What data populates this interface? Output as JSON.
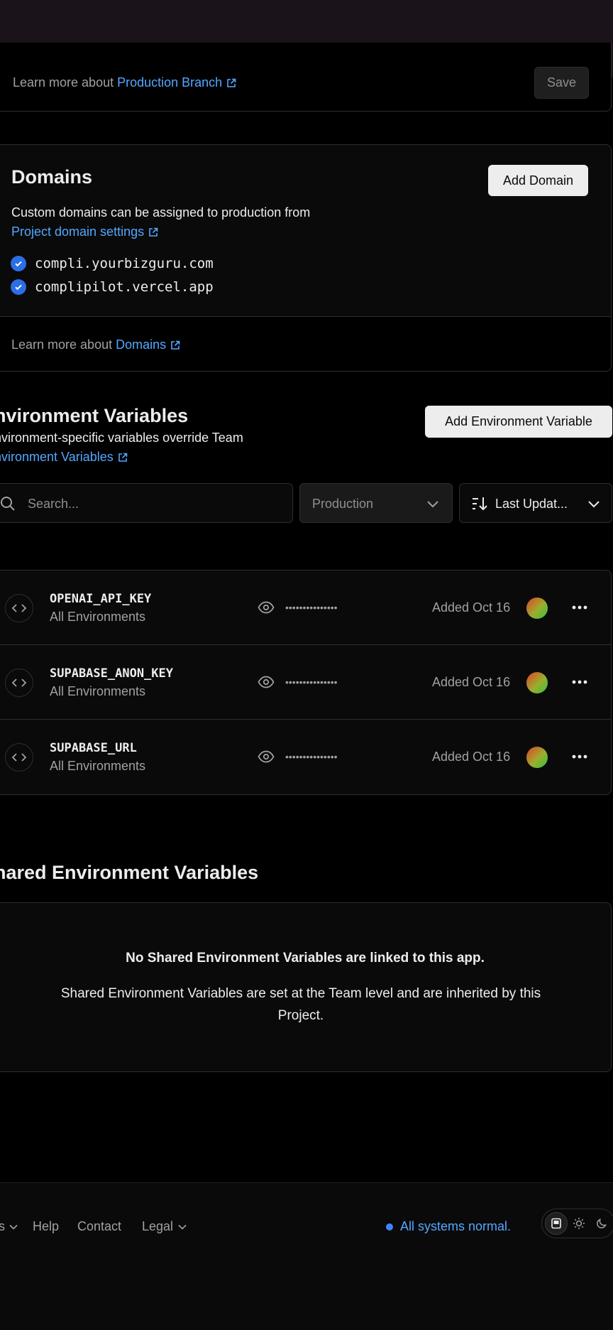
{
  "production_branch": {
    "learn_prefix": "Learn more about",
    "learn_link": "Production Branch",
    "save_label": "Save"
  },
  "domains": {
    "title": "Domains",
    "add_label": "Add Domain",
    "description": "Custom domains can be assigned to production from",
    "settings_link": "Project domain settings",
    "items": [
      "compli.yourbizguru.com",
      "complipilot.vercel.app"
    ],
    "learn_prefix": "Learn more about",
    "learn_link": "Domains"
  },
  "env": {
    "title": "nvironment Variables",
    "description": "nvironment-specific variables override Team",
    "link": "nvironment Variables",
    "add_label": "Add Environment Variable",
    "search_placeholder": "Search...",
    "environment_filter": "Production",
    "sort_label": "Last Updat...",
    "variables": [
      {
        "name": "OPENAI_API_KEY",
        "scope": "All Environments",
        "masked": "•••••••••••••••",
        "added": "Added Oct 16"
      },
      {
        "name": "SUPABASE_ANON_KEY",
        "scope": "All Environments",
        "masked": "•••••••••••••••",
        "added": "Added Oct 16"
      },
      {
        "name": "SUPABASE_URL",
        "scope": "All Environments",
        "masked": "•••••••••••••••",
        "added": "Added Oct 16"
      }
    ]
  },
  "shared": {
    "title": "hared Environment Variables",
    "empty_heading": "No Shared Environment Variables are linked to this app.",
    "empty_text": "Shared Environment Variables are set at the Team level and are inherited by this Project."
  },
  "footer": {
    "partial_item": "s",
    "help": "Help",
    "contact": "Contact",
    "legal": "Legal",
    "status": "All systems normal."
  },
  "colors": {
    "accent_link": "#52a8ff",
    "check_blue": "#2c6fe5",
    "status_dot": "#3e86ff"
  }
}
